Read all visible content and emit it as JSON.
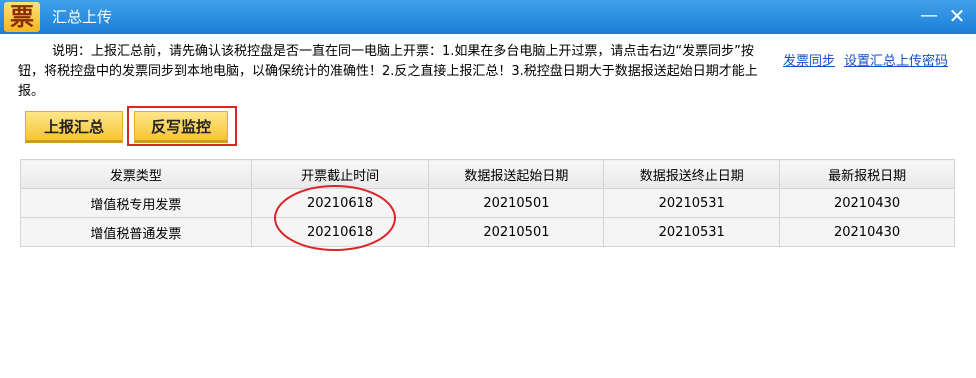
{
  "window": {
    "title": "汇总上传",
    "app_icon": "票",
    "minimize_symbol": "—",
    "close_symbol": "✕"
  },
  "notice": {
    "text": "说明：上报汇总前，请先确认该税控盘是否一直在同一电脑上开票：1.如果在多台电脑上开过票，请点击右边“发票同步”按钮，将税控盘中的发票同步到本地电脑，以确保统计的准确性！2.反之直接上报汇总！3.税控盘日期大于数据报送起始日期才能上报。"
  },
  "links": {
    "invoice_sync": "发票同步",
    "upload_password": "设置汇总上传密码"
  },
  "buttons": {
    "upload_summary": "上报汇总",
    "write_back_monitor": "反写监控"
  },
  "table": {
    "headers": [
      "发票类型",
      "开票截止时间",
      "数据报送起始日期",
      "数据报送终止日期",
      "最新报税日期"
    ],
    "rows": [
      [
        "增值税专用发票",
        "20210618",
        "20210501",
        "20210531",
        "20210430"
      ],
      [
        "增值税普通发票",
        "20210618",
        "20210501",
        "20210531",
        "20210430"
      ]
    ]
  },
  "colors": {
    "titlebar": "#1b7fd6",
    "link": "#1150c8",
    "button": "#f6c534",
    "highlight_red": "#d9262b"
  }
}
